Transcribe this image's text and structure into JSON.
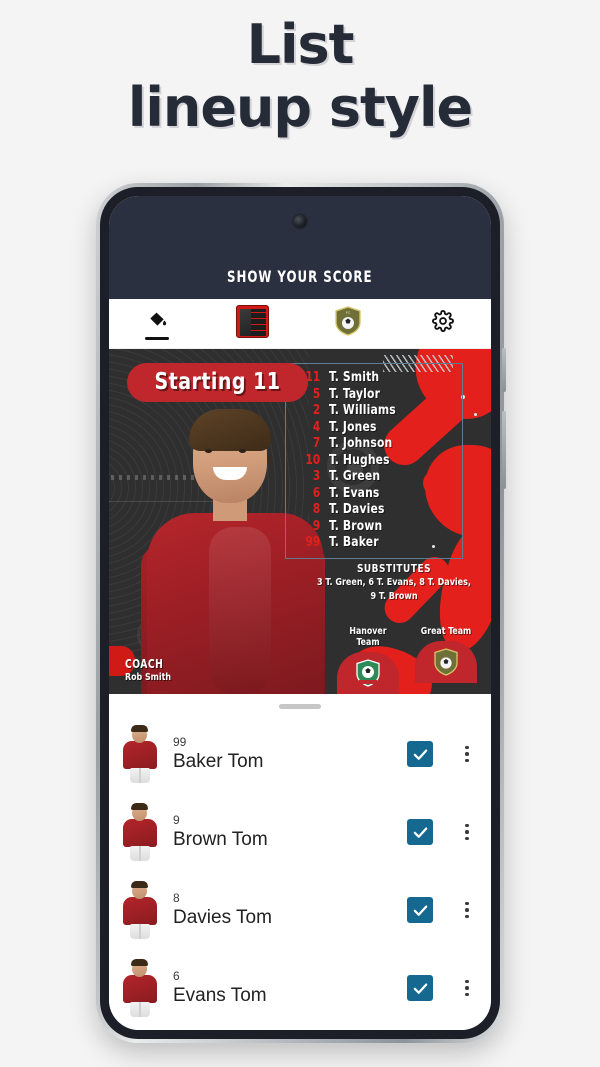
{
  "headline": {
    "line1": "List",
    "line2": "lineup style"
  },
  "app": {
    "title": "SHOW YOUR SCORE",
    "tabs": [
      {
        "label": "Fill style",
        "icon": "paint-bucket-icon",
        "active": true
      },
      {
        "label": "Template",
        "icon": "template-thumbnail-icon",
        "active": false
      },
      {
        "label": "Team badge",
        "icon": "shield-icon",
        "active": false
      },
      {
        "label": "Settings",
        "icon": "gear-icon",
        "active": false
      }
    ]
  },
  "poster": {
    "badge_label": "Starting 11",
    "lineup": [
      {
        "number": "11",
        "name": "T. Smith"
      },
      {
        "number": "5",
        "name": "T. Taylor"
      },
      {
        "number": "2",
        "name": "T. Williams"
      },
      {
        "number": "4",
        "name": "T. Jones"
      },
      {
        "number": "7",
        "name": "T. Johnson"
      },
      {
        "number": "10",
        "name": "T. Hughes"
      },
      {
        "number": "3",
        "name": "T. Green"
      },
      {
        "number": "6",
        "name": "T. Evans"
      },
      {
        "number": "8",
        "name": "T. Davies"
      },
      {
        "number": "9",
        "name": "T. Brown"
      },
      {
        "number": "99",
        "name": "T. Baker"
      }
    ],
    "substitutes_title": "SUBSTITUTES",
    "substitutes_line1": "3 T. Green, 6 T. Evans, 8 T. Davies,",
    "substitutes_line2": "9 T. Brown",
    "coach_title": "COACH",
    "coach_name": "Rob Smith",
    "teams": [
      {
        "name": "Hanover Team"
      },
      {
        "name": "Great Team"
      }
    ]
  },
  "player_list": [
    {
      "number": "99",
      "name": "Baker Tom",
      "checked": true
    },
    {
      "number": "9",
      "name": "Brown Tom",
      "checked": true
    },
    {
      "number": "8",
      "name": "Davies Tom",
      "checked": true
    },
    {
      "number": "6",
      "name": "Evans Tom",
      "checked": true
    }
  ],
  "colors": {
    "headline_text": "#262b38",
    "header_bg": "#2b3040",
    "poster_bg": "#2f2f2f",
    "accent_red": "#e3201c",
    "pill_red": "#c0272d",
    "checkbox_blue": "#15688f",
    "page_bg": "#f4f4f4"
  }
}
